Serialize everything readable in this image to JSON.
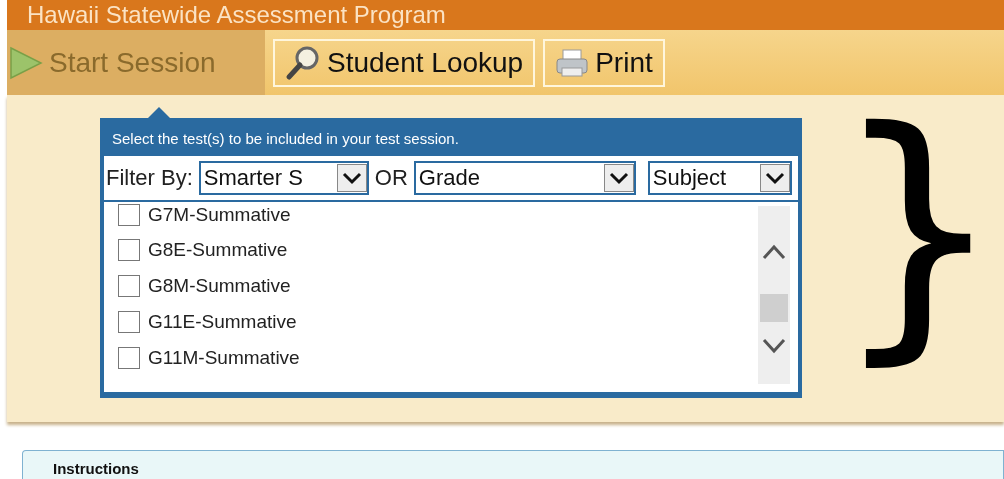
{
  "header": {
    "title": "Hawaii Statewide Assessment Program"
  },
  "toolbar": [
    {
      "label": "Start Session",
      "kind": "play",
      "selected": true
    },
    {
      "label": "Student Lookup",
      "kind": "magnifier",
      "selected": false
    },
    {
      "label": "Print",
      "kind": "printer",
      "selected": false
    }
  ],
  "test_picker": {
    "prompt": "Select the test(s) to be included in your test session.",
    "filter_label": "Filter By:",
    "filters": [
      {
        "value": "Smarter S"
      },
      {
        "value": "Grade"
      },
      {
        "value": "Subject"
      }
    ],
    "or_label": "OR",
    "tests": [
      {
        "label": "G7M-Summative",
        "checked": false
      },
      {
        "label": "G8E-Summative",
        "checked": false
      },
      {
        "label": "G8M-Summative",
        "checked": false
      },
      {
        "label": "G11E-Summative",
        "checked": false
      },
      {
        "label": "G11M-Summative",
        "checked": false
      }
    ]
  },
  "annotation": {
    "text": "}"
  },
  "instructions": {
    "title": "Instructions"
  }
}
